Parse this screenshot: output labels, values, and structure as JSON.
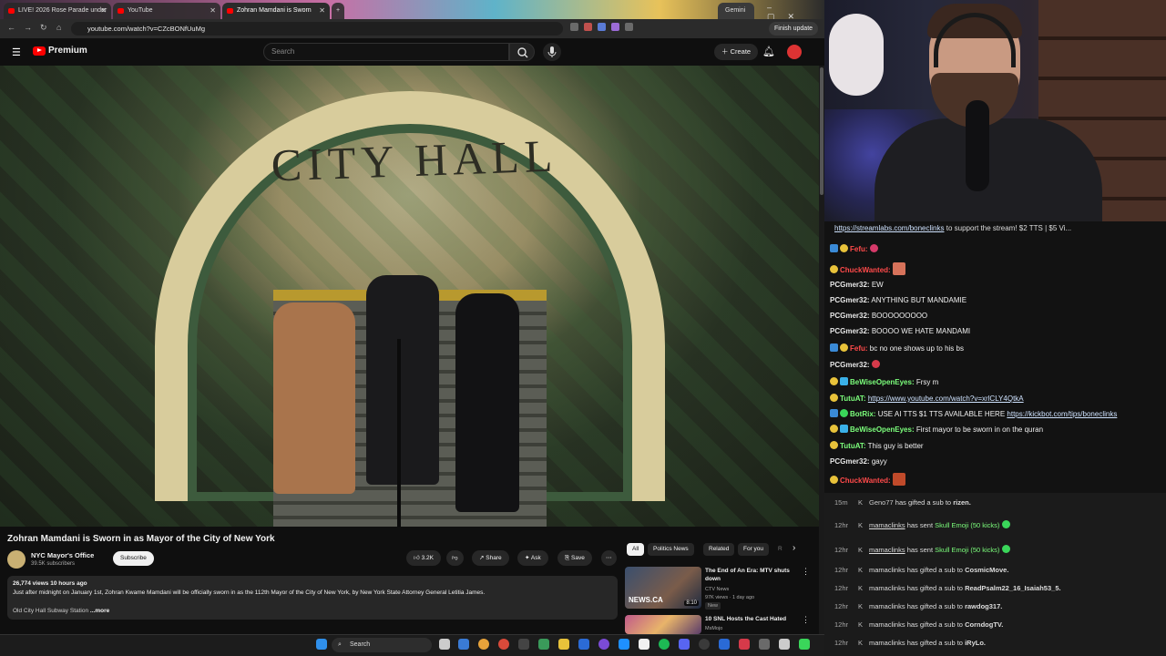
{
  "browser": {
    "tabs": [
      {
        "label": "LIVE! 2026 Rose Parade under"
      },
      {
        "label": "YouTube"
      },
      {
        "label": "Zohran Mamdani is Sworn"
      }
    ],
    "gemini_label": "Gemini",
    "url": "youtube.com/watch?v=CZcBONfUuMg",
    "finish_update": "Finish update"
  },
  "youtube": {
    "logo_text": "Premium",
    "search_placeholder": "Search",
    "create_label": "Create",
    "video_overlay_text": "CITY HALL",
    "video_title": "Zohran Mamdani is Sworn in as Mayor of the City of New York",
    "channel_name": "NYC Mayor's Office",
    "channel_subs": "39.5K subscribers",
    "subscribe_label": "Subscribe",
    "like_count": "3.2K",
    "share_label": "Share",
    "ask_label": "Ask",
    "save_label": "Save",
    "description": {
      "stats": "26,774 views  10 hours ago",
      "text": "Just after midnight on January 1st, Zohran Kwame Mamdani will be officially sworn in as the 112th Mayor of the City of New York, by New York State Attorney General Letitia James.",
      "location": "Old City Hall Subway Station",
      "more": "...more"
    },
    "chips": [
      "All",
      "Politics News",
      "Related",
      "For you",
      "R"
    ],
    "recommendations": [
      {
        "title": "The End of An Era: MTV shuts down",
        "channel": "CTV News",
        "meta": "97K views · 1 day ago",
        "badge": "New",
        "duration": "8:10",
        "thumb_text": "NEWS.CA"
      },
      {
        "title": "10 SNL Hosts the Cast Hated",
        "channel": "MsMojo",
        "meta": "",
        "badge": "",
        "duration": "",
        "thumb_text": ""
      }
    ]
  },
  "chat": {
    "pinned_link": "https://streamlabs.com/boneclinks",
    "pinned_text": "to support the stream! $2 TTS | $5 Vi...",
    "messages": [
      {
        "user": "Fefu:",
        "text": "",
        "color": "red"
      },
      {
        "user": "ChuckWanted:",
        "text": "",
        "color": "red"
      },
      {
        "user": "PCGmer32:",
        "text": "EW",
        "color": "white"
      },
      {
        "user": "PCGmer32:",
        "text": "ANYTHING BUT MANDAMIE",
        "color": "white"
      },
      {
        "user": "PCGmer32:",
        "text": "BOOOOOOOOO",
        "color": "white"
      },
      {
        "user": "PCGmer32:",
        "text": "BOOOO WE HATE MANDAMI",
        "color": "white"
      },
      {
        "user": "Fefu:",
        "text": "bc no one shows up to his bs",
        "color": "red"
      },
      {
        "user": "PCGmer32:",
        "text": "",
        "color": "white"
      },
      {
        "user": "BeWiseOpenEyes:",
        "text": "Frsy m",
        "color": "green"
      },
      {
        "user": "TutuAT:",
        "text": "https://www.youtube.com/watch?v=xrlCLY4QtkA",
        "color": "green",
        "link": true
      },
      {
        "user": "BotRix:",
        "text": "USE AI TTS $1 TTS AVAILABLE HERE",
        "link_text": "https://kickbot.com/tips/boneclinks",
        "color": "green"
      },
      {
        "user": "BeWiseOpenEyes:",
        "text": "First mayor to be sworn in on the quran",
        "color": "green"
      },
      {
        "user": "TutuAT:",
        "text": "This guy is better",
        "color": "green"
      },
      {
        "user": "PCGmer32:",
        "text": "gayy",
        "color": "white"
      },
      {
        "user": "ChuckWanted:",
        "text": "",
        "color": "red"
      }
    ],
    "alerts": [
      {
        "time": "15m",
        "user": "Geno77",
        "text": "has gifted a sub to",
        "target": "rizen."
      },
      {
        "time": "12hr",
        "user": "mamaclinks",
        "text": "has sent",
        "target": "Skull Emoji (50 kicks)"
      },
      {
        "time": "12hr",
        "user": "mamaclinks",
        "text": "has sent",
        "target": "Skull Emoji (50 kicks)"
      },
      {
        "time": "12hr",
        "user": "mamaclinks",
        "text": "has gifted a sub to",
        "target": "CosmicMove."
      },
      {
        "time": "12hr",
        "user": "mamaclinks",
        "text": "has gifted a sub to",
        "target": "ReadPsalm22_16_Isaiah53_5."
      },
      {
        "time": "12hr",
        "user": "mamaclinks",
        "text": "has gifted a sub to",
        "target": "rawdog317."
      },
      {
        "time": "12hr",
        "user": "mamaclinks",
        "text": "has gifted a sub to",
        "target": "CorndogTV."
      },
      {
        "time": "12hr",
        "user": "mamaclinks",
        "text": "has gifted a sub to",
        "target": "iRyLo."
      }
    ]
  },
  "taskbar": {
    "search_label": "Search"
  }
}
